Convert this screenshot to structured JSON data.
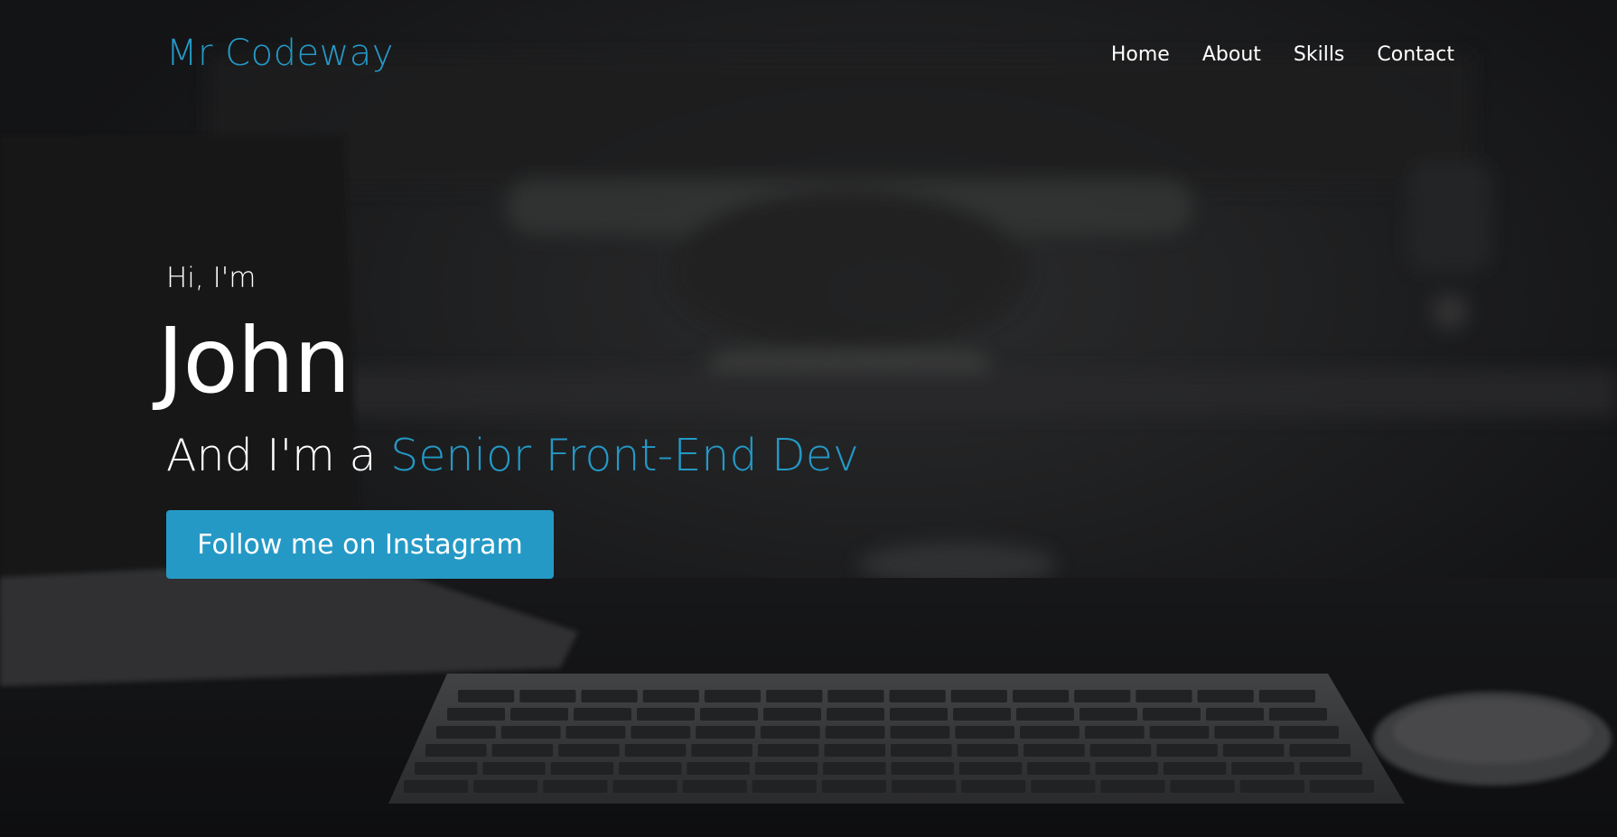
{
  "colors": {
    "accent": "#2499c7",
    "button_bg": "#2599c6",
    "text": "#ffffff",
    "overlay": "#111214"
  },
  "nav": {
    "brand": "Mr Codeway",
    "links": [
      "Home",
      "About",
      "Skills",
      "Contact"
    ]
  },
  "hero": {
    "greeting": "Hi, I'm",
    "name": "John",
    "role_prefix": "And I'm a ",
    "role_highlight": "Senior Front-End Dev",
    "cta_label": "Follow me on Instagram"
  }
}
